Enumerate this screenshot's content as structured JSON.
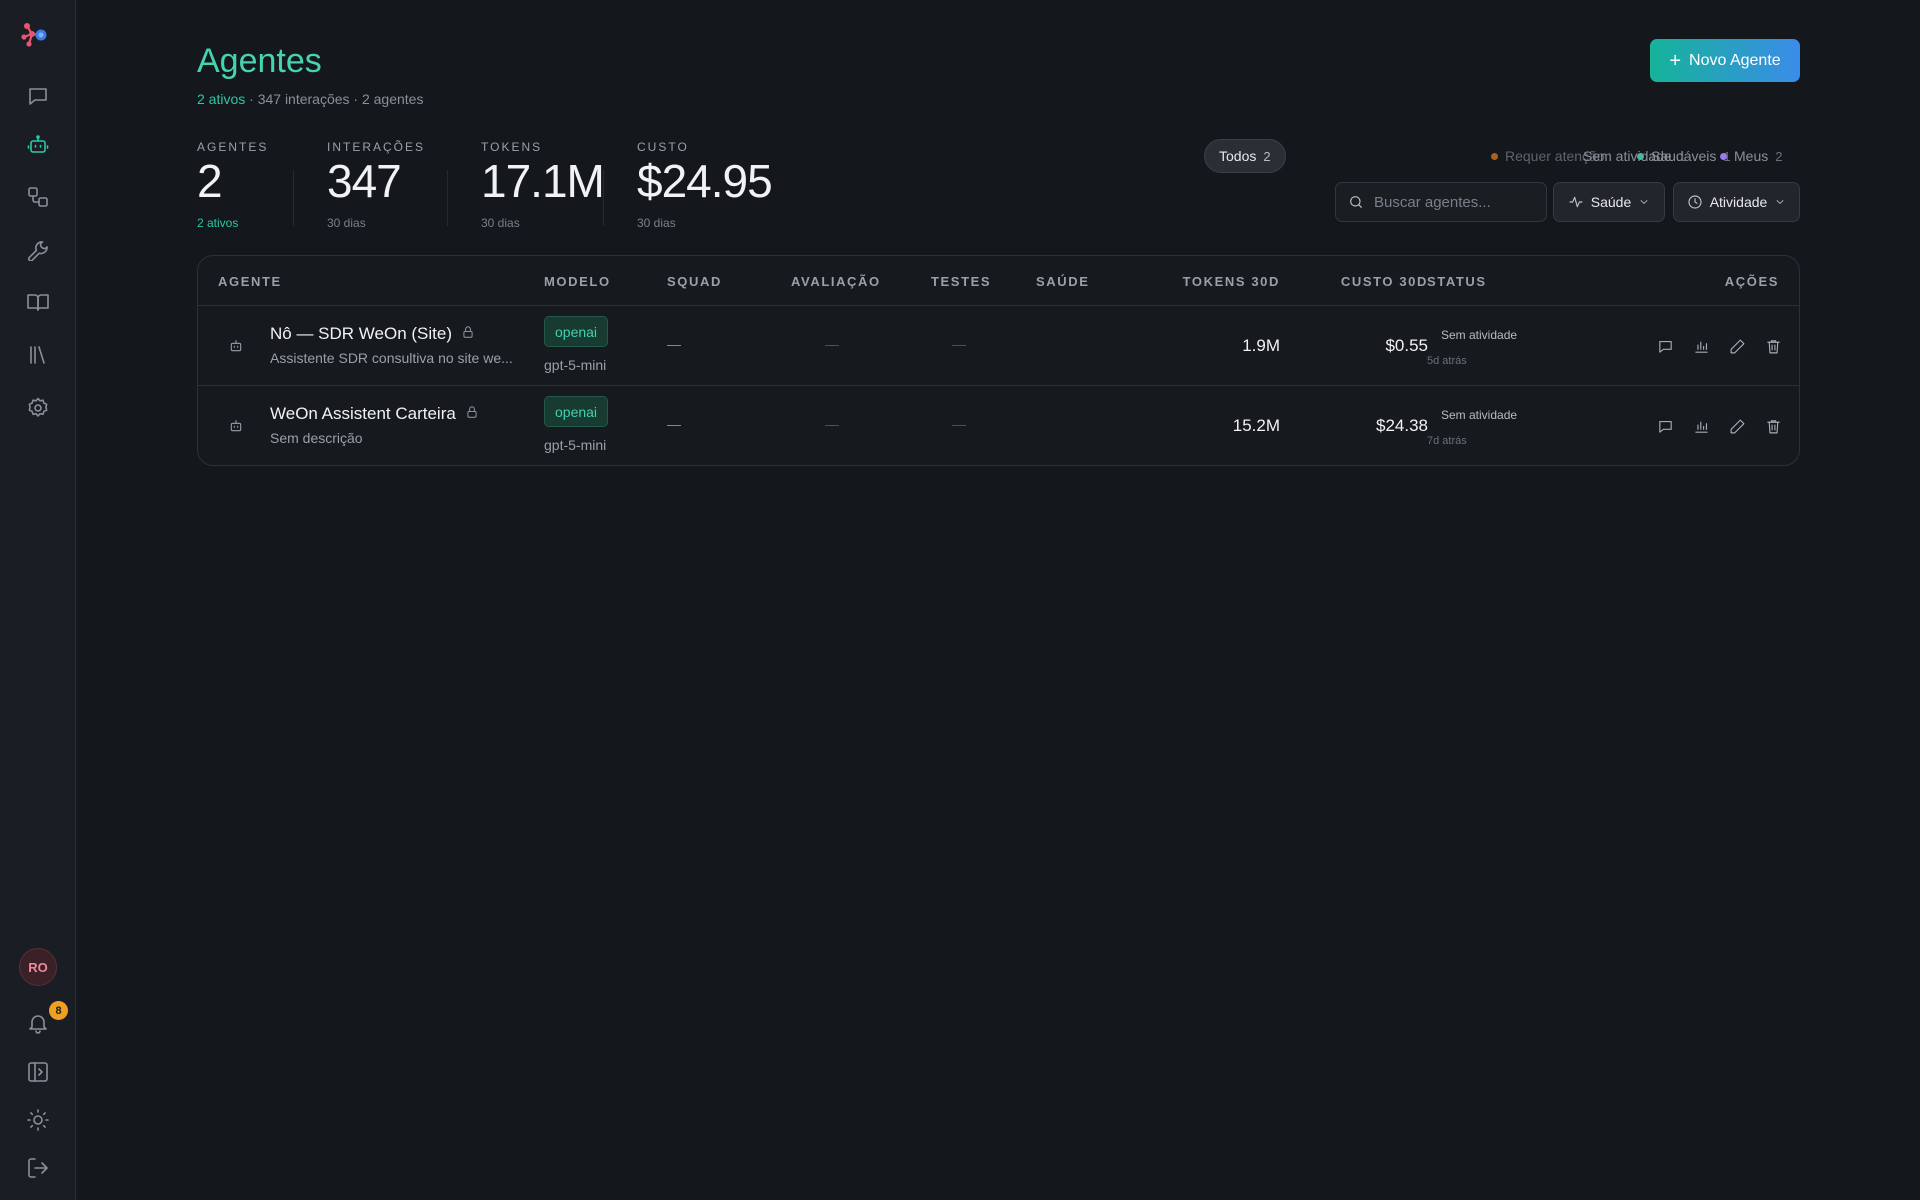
{
  "sidebar": {
    "avatar_initials": "RO",
    "notifications_count": "8",
    "items": [
      {
        "name": "chat-icon"
      },
      {
        "name": "bot-icon",
        "active": true
      },
      {
        "name": "workflow-icon"
      },
      {
        "name": "wrench-icon"
      },
      {
        "name": "book-icon"
      },
      {
        "name": "library-icon"
      },
      {
        "name": "gear-icon"
      }
    ]
  },
  "header": {
    "title": "Agentes",
    "subtitle_active": "2 ativos",
    "subtitle_rest": " · 347 interações · 2 agentes",
    "new_button_label": "Novo Agente"
  },
  "stats": [
    {
      "label": "AGENTES",
      "value": "2",
      "sub": "2 ativos",
      "sub_color": "green"
    },
    {
      "label": "INTERAÇÕES",
      "value": "347",
      "sub": "30 dias"
    },
    {
      "label": "TOKENS",
      "value": "17.1M",
      "sub": "30 dias"
    },
    {
      "label": "CUSTO",
      "value": "$24.95",
      "sub": "30 dias"
    }
  ],
  "filters": {
    "chips": [
      {
        "label": "Todos",
        "count": "2",
        "active": true
      },
      {
        "label": "Requer atenção",
        "count": "",
        "dot": "#a8641c"
      },
      {
        "label": "Saudáveis",
        "count": "1",
        "dot": "#2bc8a4"
      },
      {
        "label": "Sem atividade",
        "count": "1"
      },
      {
        "label": "Meus",
        "count": "2",
        "dot": "#9b7af0"
      }
    ],
    "search_placeholder": "Buscar agentes...",
    "health_dropdown": "Saúde",
    "activity_dropdown": "Atividade"
  },
  "table": {
    "columns": {
      "agent": "AGENTE",
      "model": "MODELO",
      "squad": "SQUAD",
      "rating": "AVALIAÇÃO",
      "tests": "TESTES",
      "health": "SAÚDE",
      "tokens": "TOKENS 30D",
      "cost": "CUSTO 30D",
      "status": "STATUS",
      "actions": "AÇÕES"
    },
    "rows": [
      {
        "name": "Nô — SDR WeOn (Site)",
        "description": "Assistente SDR consultiva no site we...",
        "provider": "openai",
        "model": "gpt-5-mini",
        "squad": "—",
        "rating": "—",
        "tests": "—",
        "tokens": "1.9M",
        "cost": "$0.55",
        "status": "Sem atividade",
        "last_seen": "5d atrás"
      },
      {
        "name": "WeOn Assistent Carteira",
        "description": "Sem descrição",
        "provider": "openai",
        "model": "gpt-5-mini",
        "squad": "—",
        "rating": "—",
        "tests": "—",
        "tokens": "15.2M",
        "cost": "$24.38",
        "status": "Sem atividade",
        "last_seen": "7d atrás"
      }
    ]
  }
}
